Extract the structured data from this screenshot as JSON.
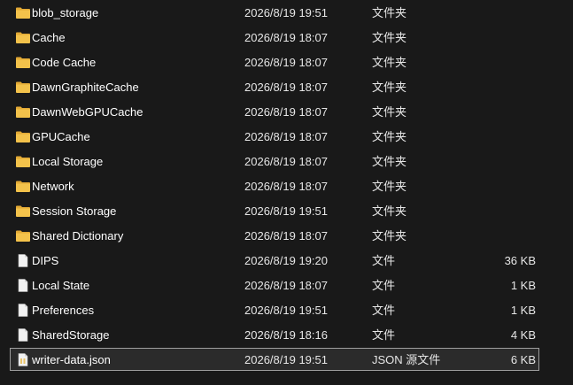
{
  "colors": {
    "background": "#191919",
    "folder": "#f3c24b",
    "folder_tab": "#e2a935",
    "file_page": "#f2f2f2",
    "json_icon_accent": "#e9c46a",
    "selection_border": "#9e9e9e"
  },
  "files": [
    {
      "name": "blob_storage",
      "date": "2026/8/19 19:51",
      "type": "文件夹",
      "size": "",
      "icon": "folder-icon",
      "selected": false
    },
    {
      "name": "Cache",
      "date": "2026/8/19 18:07",
      "type": "文件夹",
      "size": "",
      "icon": "folder-icon",
      "selected": false
    },
    {
      "name": "Code Cache",
      "date": "2026/8/19 18:07",
      "type": "文件夹",
      "size": "",
      "icon": "folder-icon",
      "selected": false
    },
    {
      "name": "DawnGraphiteCache",
      "date": "2026/8/19 18:07",
      "type": "文件夹",
      "size": "",
      "icon": "folder-icon",
      "selected": false
    },
    {
      "name": "DawnWebGPUCache",
      "date": "2026/8/19 18:07",
      "type": "文件夹",
      "size": "",
      "icon": "folder-icon",
      "selected": false
    },
    {
      "name": "GPUCache",
      "date": "2026/8/19 18:07",
      "type": "文件夹",
      "size": "",
      "icon": "folder-icon",
      "selected": false
    },
    {
      "name": "Local Storage",
      "date": "2026/8/19 18:07",
      "type": "文件夹",
      "size": "",
      "icon": "folder-icon",
      "selected": false
    },
    {
      "name": "Network",
      "date": "2026/8/19 18:07",
      "type": "文件夹",
      "size": "",
      "icon": "folder-icon",
      "selected": false
    },
    {
      "name": "Session Storage",
      "date": "2026/8/19 19:51",
      "type": "文件夹",
      "size": "",
      "icon": "folder-icon",
      "selected": false
    },
    {
      "name": "Shared Dictionary",
      "date": "2026/8/19 18:07",
      "type": "文件夹",
      "size": "",
      "icon": "folder-icon",
      "selected": false
    },
    {
      "name": "DIPS",
      "date": "2026/8/19 19:20",
      "type": "文件",
      "size": "36 KB",
      "icon": "file-icon",
      "selected": false
    },
    {
      "name": "Local State",
      "date": "2026/8/19 18:07",
      "type": "文件",
      "size": "1 KB",
      "icon": "file-icon",
      "selected": false
    },
    {
      "name": "Preferences",
      "date": "2026/8/19 19:51",
      "type": "文件",
      "size": "1 KB",
      "icon": "file-icon",
      "selected": false
    },
    {
      "name": "SharedStorage",
      "date": "2026/8/19 18:16",
      "type": "文件",
      "size": "4 KB",
      "icon": "file-icon",
      "selected": false
    },
    {
      "name": "writer-data.json",
      "date": "2026/8/19 19:51",
      "type": "JSON 源文件",
      "size": "6 KB",
      "icon": "json-file-icon",
      "selected": true
    }
  ]
}
